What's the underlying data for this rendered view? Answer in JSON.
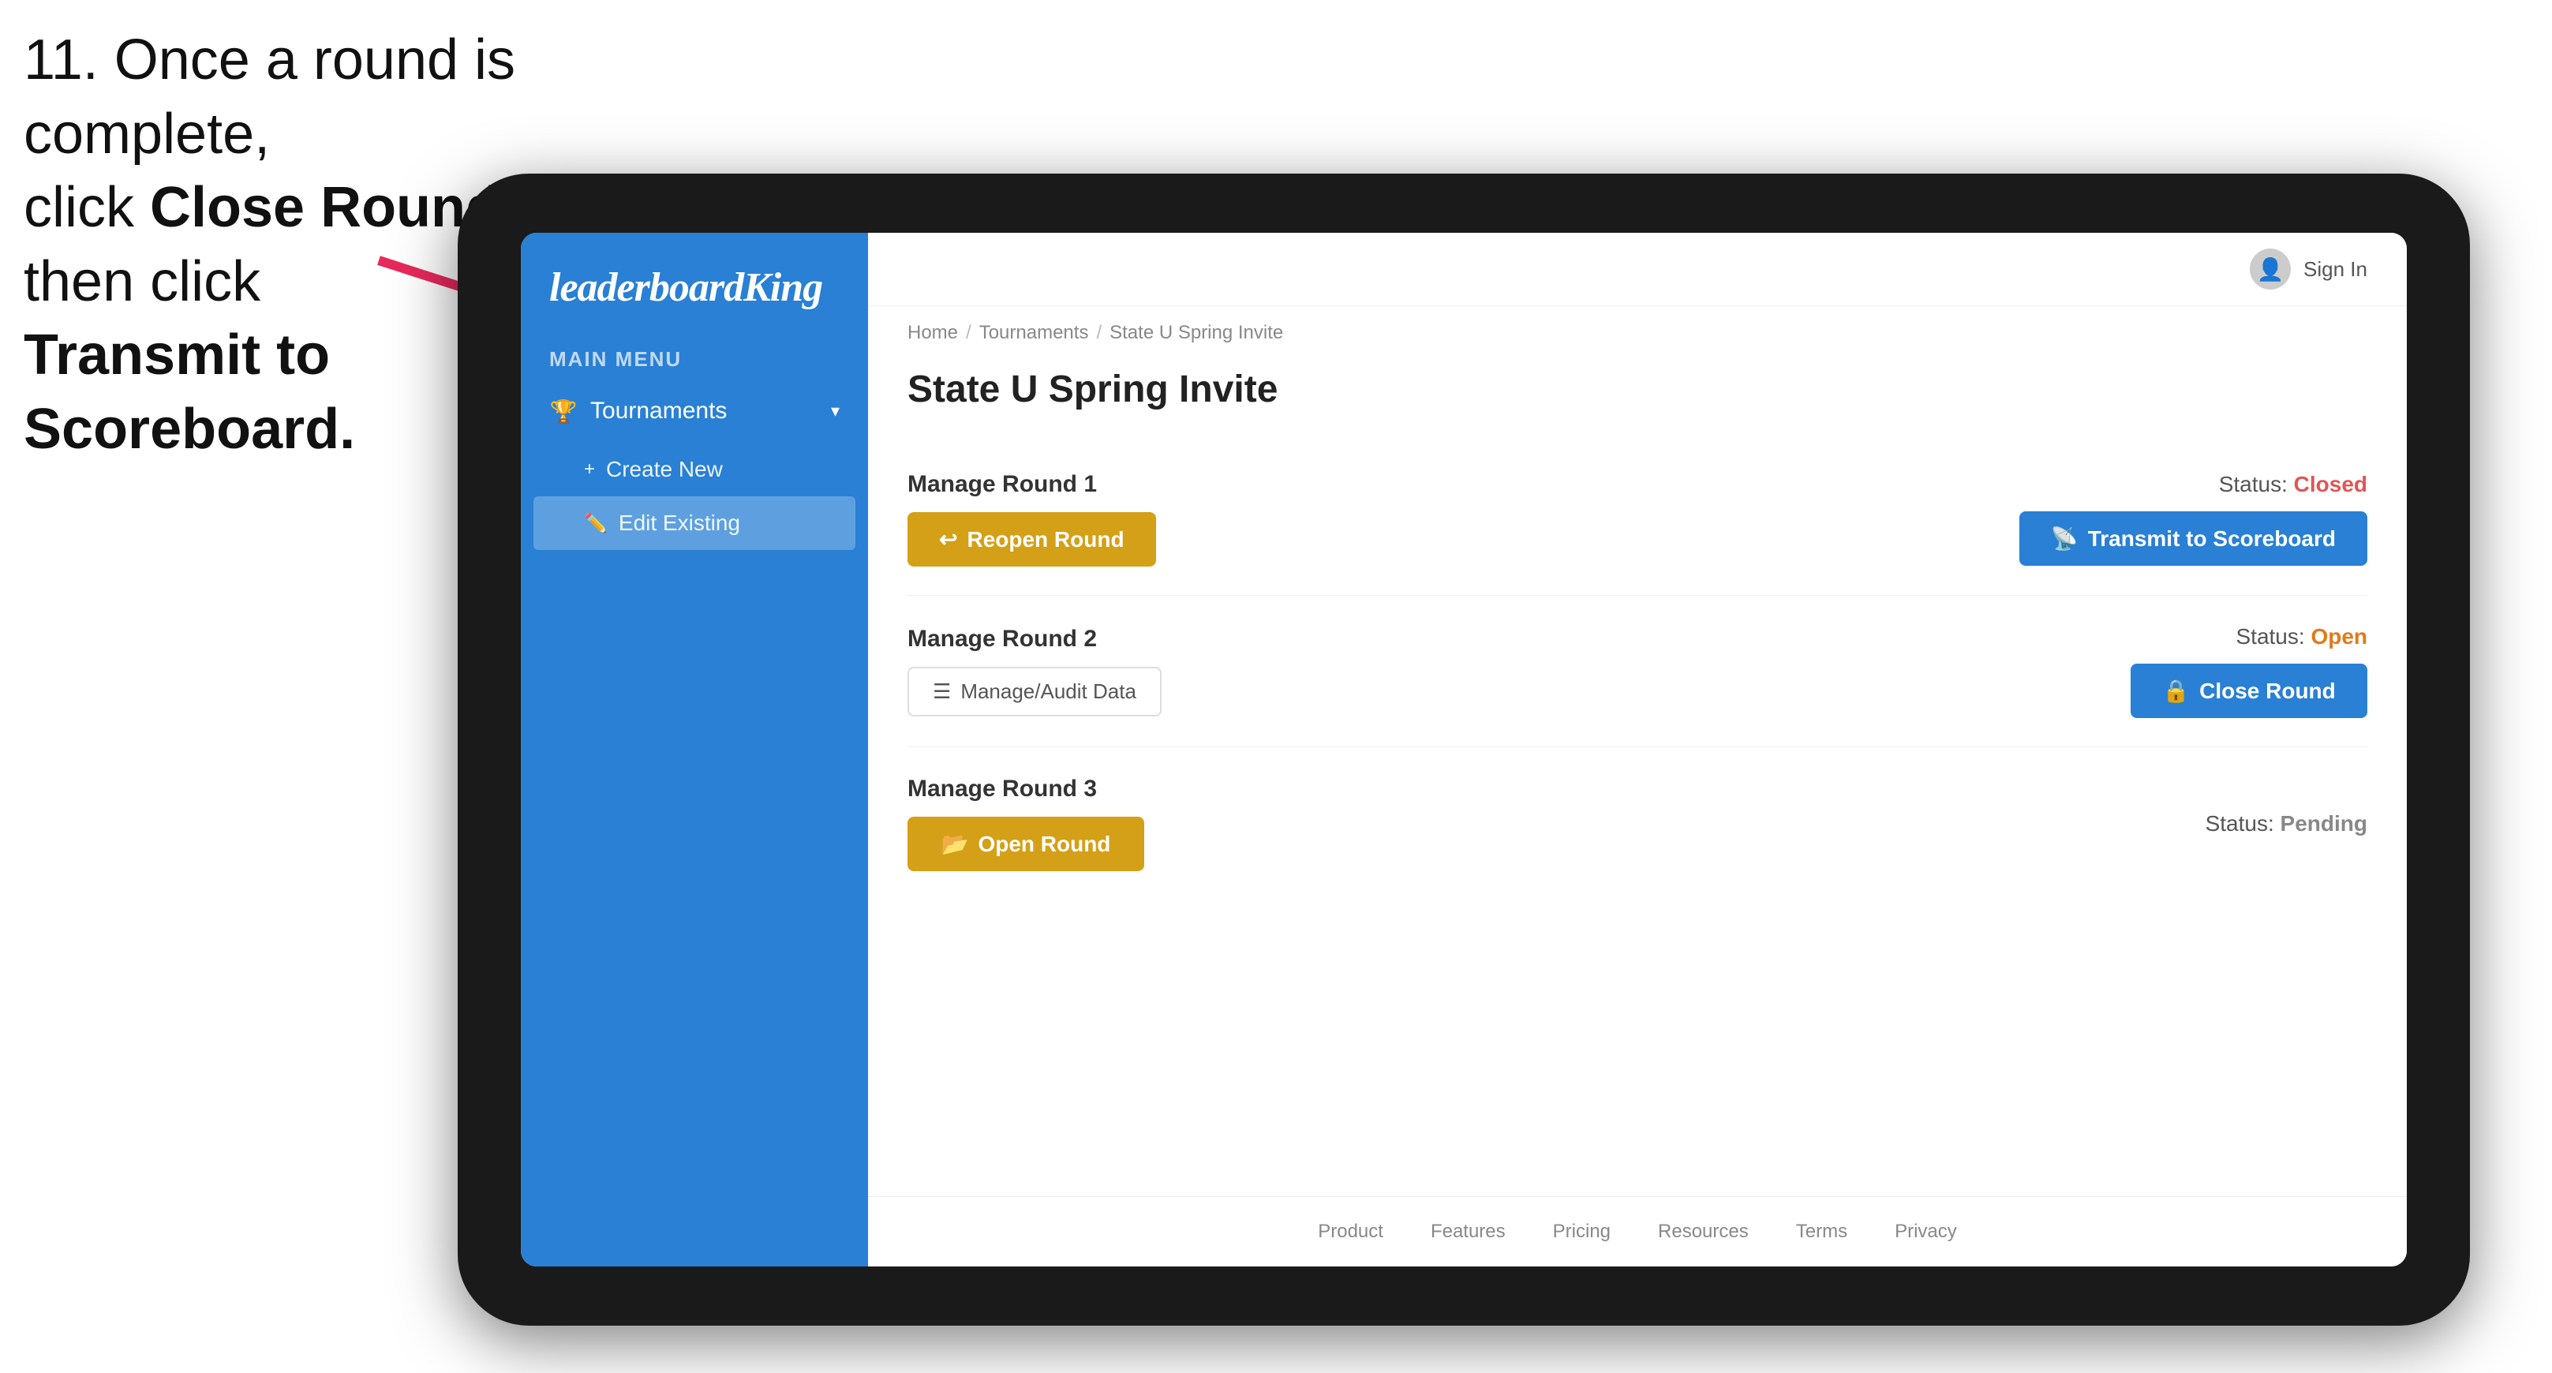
{
  "instruction": {
    "line1": "11. Once a round is complete,",
    "line2_prefix": "click ",
    "line2_bold": "Close Round",
    "line2_suffix": " then click",
    "line3_bold": "Transmit to Scoreboard."
  },
  "app": {
    "logo": {
      "text_normal": "leaderboard",
      "text_italic": "King"
    },
    "sidebar": {
      "menu_label": "MAIN MENU",
      "items": [
        {
          "label": "Tournaments",
          "icon": "🏆",
          "expanded": true
        }
      ],
      "sub_items": [
        {
          "label": "Create New",
          "icon": "+"
        },
        {
          "label": "Edit Existing",
          "icon": "✏️",
          "active": true
        }
      ]
    },
    "topnav": {
      "sign_in": "Sign In"
    },
    "breadcrumb": {
      "items": [
        "Home",
        "Tournaments",
        "State U Spring Invite"
      ]
    },
    "page": {
      "title": "State U Spring Invite",
      "rounds": [
        {
          "label": "Manage Round 1",
          "status_label": "Status:",
          "status_value": "Closed",
          "status_type": "closed",
          "left_button": {
            "label": "Reopen Round",
            "type": "gold"
          },
          "right_button": {
            "label": "Transmit to Scoreboard",
            "type": "blue"
          }
        },
        {
          "label": "Manage Round 2",
          "status_label": "Status:",
          "status_value": "Open",
          "status_type": "open",
          "left_button": {
            "label": "Manage/Audit Data",
            "type": "outline"
          },
          "right_button": {
            "label": "Close Round",
            "type": "blue"
          }
        },
        {
          "label": "Manage Round 3",
          "status_label": "Status:",
          "status_value": "Pending",
          "status_type": "pending",
          "left_button": {
            "label": "Open Round",
            "type": "gold"
          },
          "right_button": null
        }
      ]
    },
    "footer": {
      "links": [
        "Product",
        "Features",
        "Pricing",
        "Resources",
        "Terms",
        "Privacy"
      ]
    }
  }
}
